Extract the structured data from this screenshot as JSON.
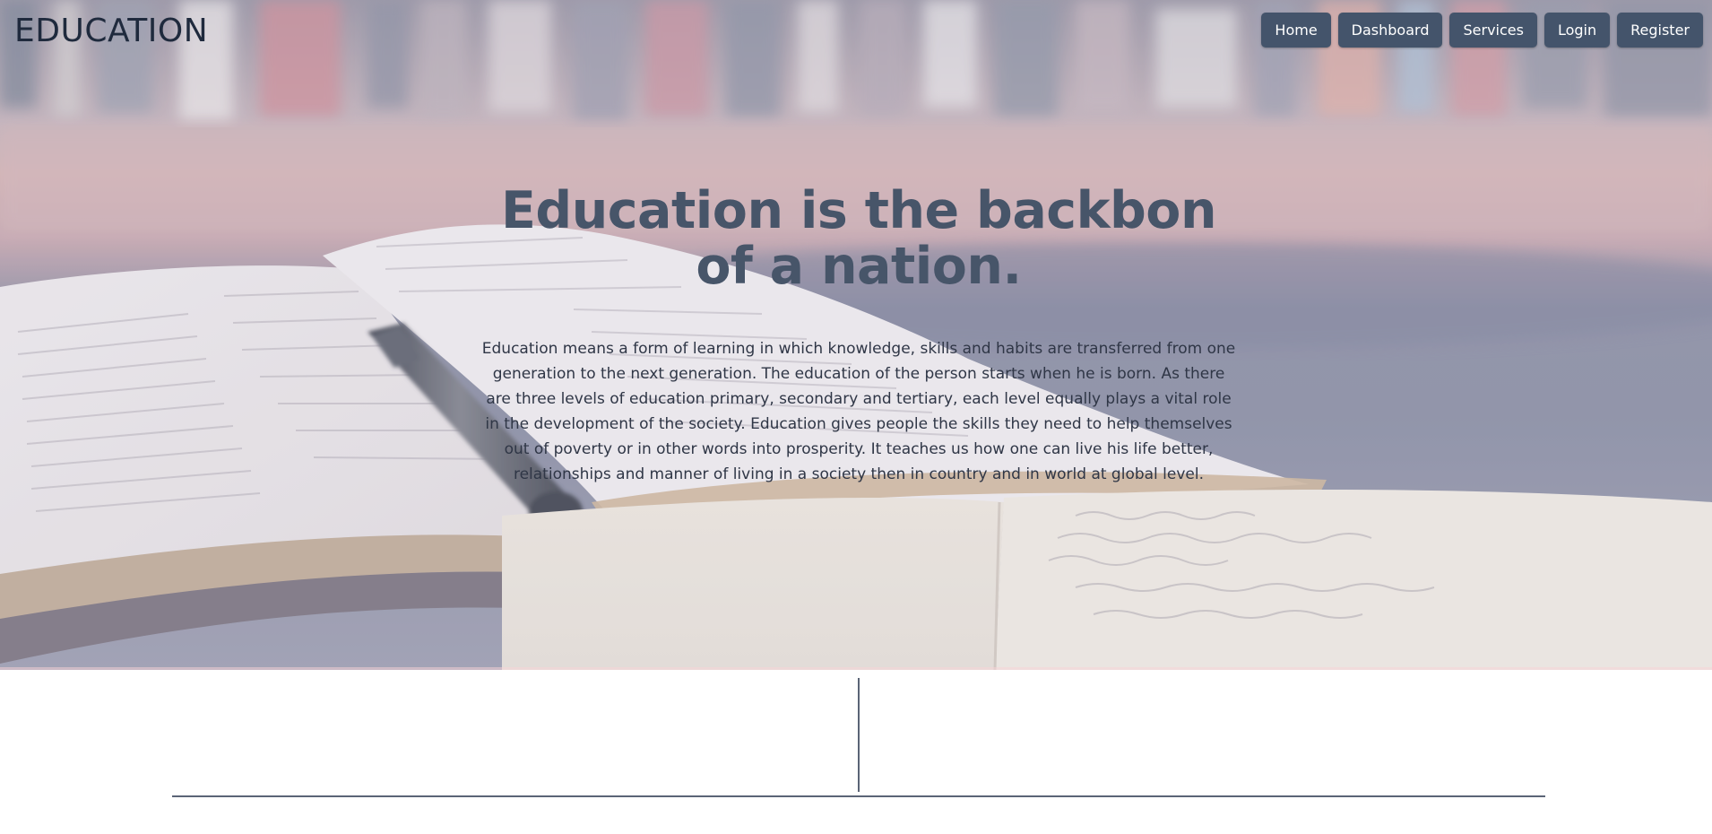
{
  "brand": {
    "title": "EDUCATION"
  },
  "nav": {
    "items": [
      {
        "label": "Home"
      },
      {
        "label": "Dashboard"
      },
      {
        "label": "Services"
      },
      {
        "label": "Login"
      },
      {
        "label": "Register"
      }
    ]
  },
  "hero": {
    "heading": "Education is the backbon of a nation.",
    "paragraph": "Education means a form of learning in which knowledge, skills and habits are transferred from one generation to the next generation. The education of the person starts when he is born. As there are three levels of education primary, secondary and tertiary, each level equally plays a vital role in the development of the society. Education gives people the skills they need to help themselves out of poverty or in other words into prosperity. It teaches us how one can live his life better, relationships and manner of living in a society then in country and in world at global level."
  },
  "colors": {
    "nav_button_bg": "#44546b",
    "nav_button_text": "#ffffff",
    "brand_text": "#1f2a3d",
    "heading_text": "#475569",
    "divider": "#5b6476"
  }
}
